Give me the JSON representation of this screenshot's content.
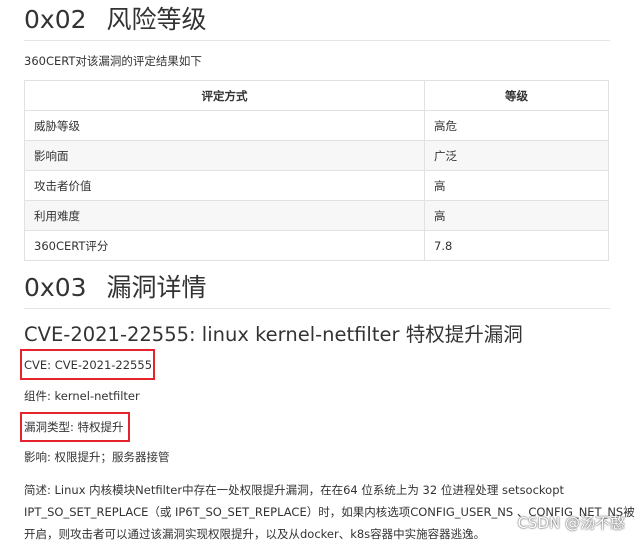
{
  "section1": {
    "number": "0x02",
    "title": "风险等级"
  },
  "intro": "360CERT对该漏洞的评定结果如下",
  "risk_table": {
    "headers": [
      "评定方式",
      "等级"
    ],
    "rows": [
      [
        "威胁等级",
        "高危"
      ],
      [
        "影响面",
        "广泛"
      ],
      [
        "攻击者价值",
        "高"
      ],
      [
        "利用难度",
        "高"
      ],
      [
        "360CERT评分",
        "7.8"
      ]
    ]
  },
  "section2": {
    "number": "0x03",
    "title": "漏洞详情"
  },
  "vuln": {
    "heading": "CVE-2021-22555: linux kernel-netfilter 特权提升漏洞",
    "cve": "CVE: CVE-2021-22555",
    "component": "组件: kernel-netfilter",
    "type": "漏洞类型: 特权提升",
    "impact": "影响: 权限提升；服务器接管",
    "description_lines": [
      "简述: Linux 内核模块Netfilter中存在一处权限提升漏洞，在在64 位系统上为 32 位进程处理 setsockopt",
      "IPT_SO_SET_REPLACE（或 IP6T_SO_SET_REPLACE）时，如果内核选项CONFIG_USER_NS 、CONFIG_NET_NS被",
      "开启，则攻击者可以通过该漏洞实现权限提升，以及从docker、k8s容器中实施容器逃逸。"
    ]
  },
  "watermark": "CSDN @汤不憨",
  "colors": {
    "highlight_box": "#e5232e",
    "table_border": "#dfe2e5",
    "stripe": "#f7f7f7"
  }
}
